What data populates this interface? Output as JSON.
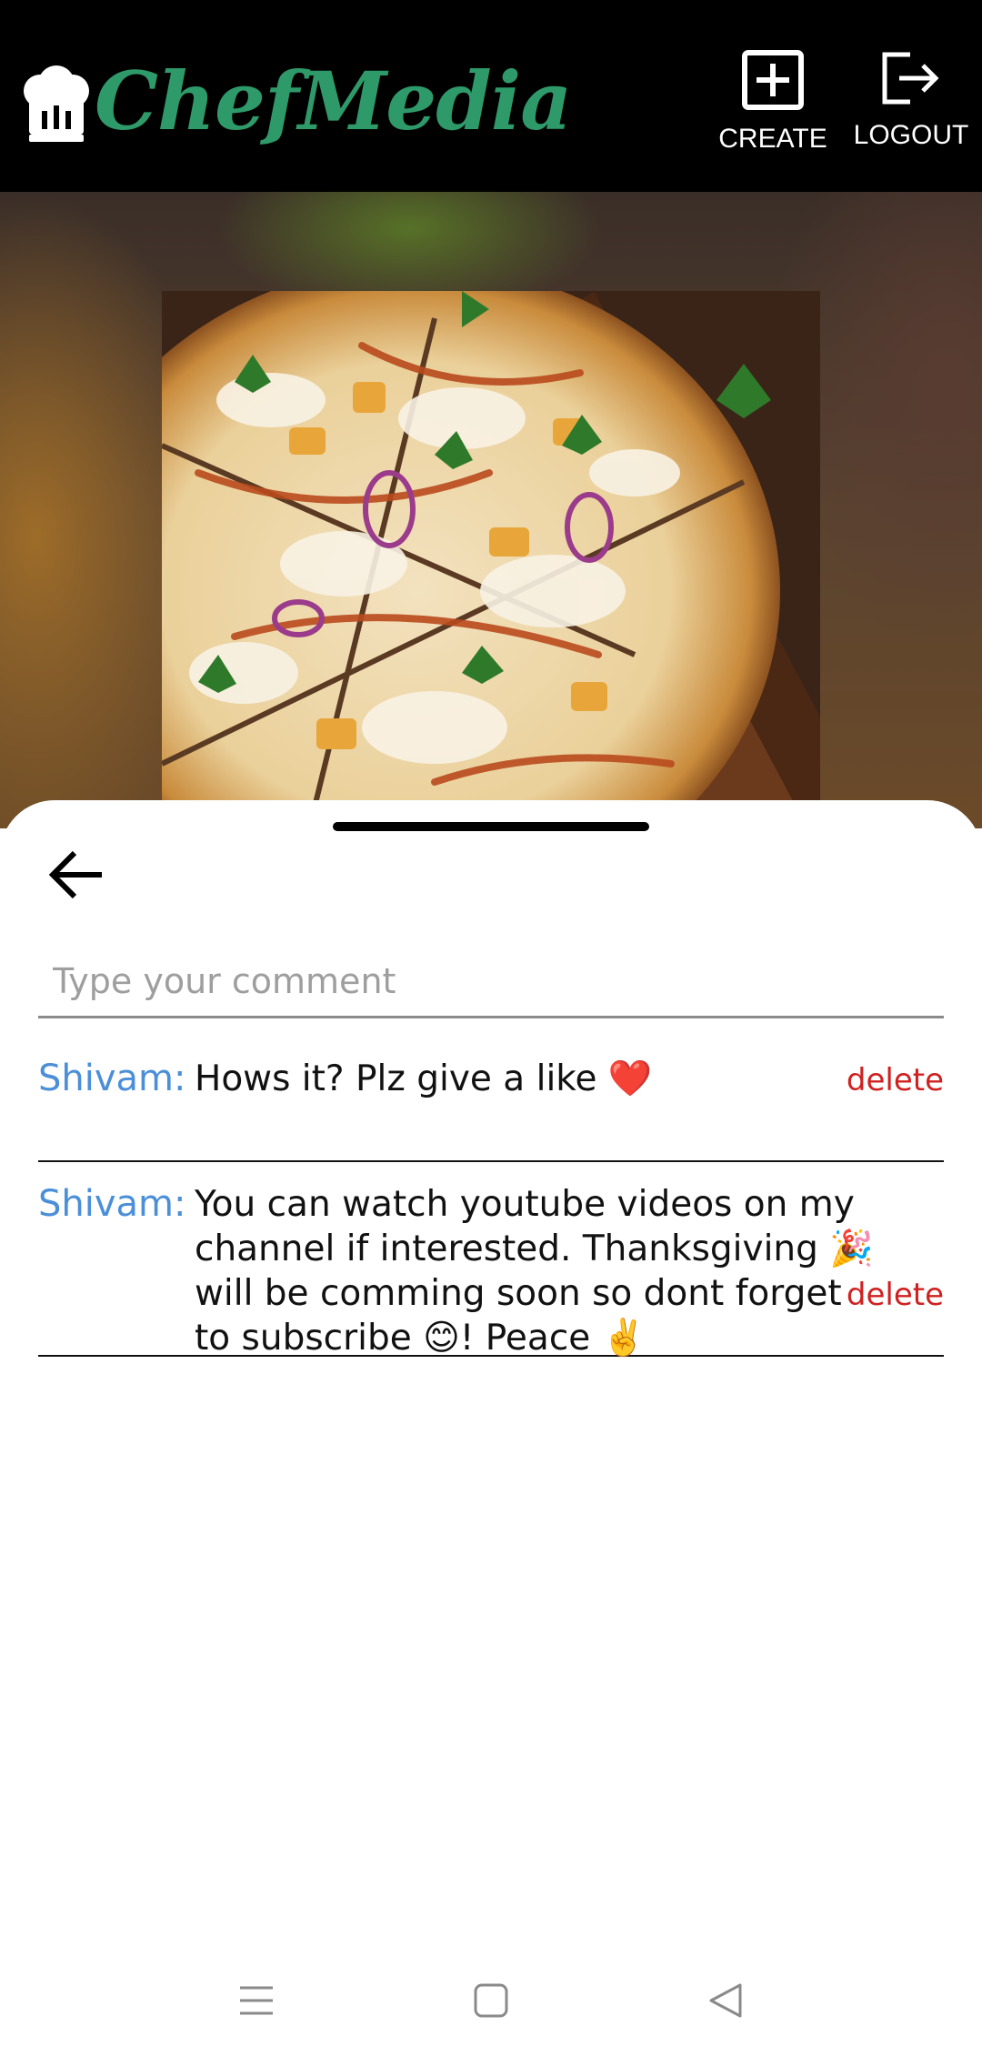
{
  "app": {
    "brand": "ChefMedia",
    "brand_color": "#2e9a6a",
    "header_bg": "#000000"
  },
  "header": {
    "create_label": "CREATE",
    "logout_label": "LOGOUT",
    "create_icon": "plus-square-icon",
    "logout_icon": "logout-icon",
    "logo_icon": "chef-hat-icon"
  },
  "post": {
    "image_subject": "pizza"
  },
  "sheet": {
    "back_icon": "arrow-left-icon",
    "comment_placeholder": "Type your comment",
    "comment_value": ""
  },
  "comments": [
    {
      "author": "Shivam:",
      "text": "Hows it? Plz give a like ❤️",
      "delete_label": "delete"
    },
    {
      "author": "Shivam:",
      "text": "You can watch youtube videos on my channel if interested. Thanksgiving 🎉 will be comming soon so dont forget to subscribe 😊! Peace ✌️",
      "delete_label": "delete"
    }
  ],
  "colors": {
    "author": "#4a8fd8",
    "delete": "#d02121"
  },
  "navbar": {
    "icons": [
      "menu-icon",
      "home-square-icon",
      "back-triangle-icon"
    ]
  }
}
